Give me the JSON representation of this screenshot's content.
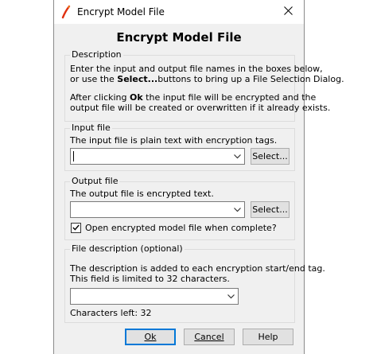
{
  "window": {
    "title": "Encrypt Model File",
    "heading": "Encrypt Model File"
  },
  "description": {
    "legend": "Description",
    "line1": "Enter the input and output file names in the boxes below,",
    "line2_pre": "or use the ",
    "line2_bold": "Select...",
    "line2_post": "buttons to bring up a File Selection Dialog.",
    "line3_pre": "After clicking ",
    "line3_bold": "Ok",
    "line3_post": " the input file will be encrypted and the",
    "line4": "output file will be created or overwritten if it already exists."
  },
  "input_file": {
    "legend": "Input file",
    "text": "The input file is plain text with encryption tags.",
    "value": "",
    "select_label": "Select..."
  },
  "output_file": {
    "legend": "Output file",
    "text": "The output file is encrypted text.",
    "value": "",
    "select_label": "Select...",
    "checkbox_label": "Open encrypted model file when complete?",
    "checkbox_checked": true
  },
  "file_description": {
    "legend": "File description (optional)",
    "line1": "The description is added to each encryption start/end tag.",
    "line2": "This field is limited to 32 characters.",
    "value": "",
    "chars_left": "Characters left: 32"
  },
  "buttons": {
    "ok": "Ok",
    "cancel": "Cancel",
    "help": "Help"
  }
}
